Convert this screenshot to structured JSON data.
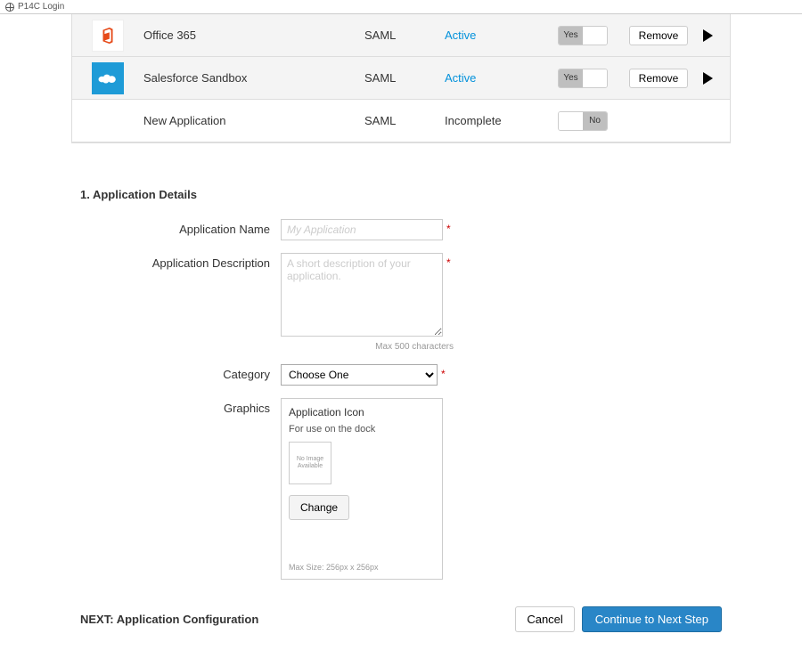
{
  "tab": {
    "title": "P14C Login"
  },
  "apps": [
    {
      "name": "Office 365",
      "protocol": "SAML",
      "status": "Active",
      "status_class": "link",
      "toggle": "Yes",
      "toggle_state": "on",
      "remove": "Remove"
    },
    {
      "name": "Salesforce Sandbox",
      "protocol": "SAML",
      "status": "Active",
      "status_class": "link",
      "toggle": "Yes",
      "toggle_state": "on",
      "remove": "Remove"
    },
    {
      "name": "New Application",
      "protocol": "SAML",
      "status": "Incomplete",
      "status_class": "plain",
      "toggle": "No",
      "toggle_state": "off"
    }
  ],
  "section": {
    "title": "1. Application Details"
  },
  "form": {
    "name": {
      "label": "Application Name",
      "placeholder": "My Application"
    },
    "description": {
      "label": "Application Description",
      "placeholder": "A short description of your application.",
      "hint": "Max 500 characters"
    },
    "category": {
      "label": "Category",
      "option": "Choose One"
    },
    "graphics": {
      "label": "Graphics",
      "box_title": "Application Icon",
      "box_sub": "For use on the dock",
      "placeholder": "No Image Available",
      "change": "Change",
      "hint": "Max Size: 256px x 256px"
    }
  },
  "footer": {
    "next_prefix": "NEXT: ",
    "next_label": "Application Configuration",
    "cancel": "Cancel",
    "continue": "Continue to Next Step"
  }
}
